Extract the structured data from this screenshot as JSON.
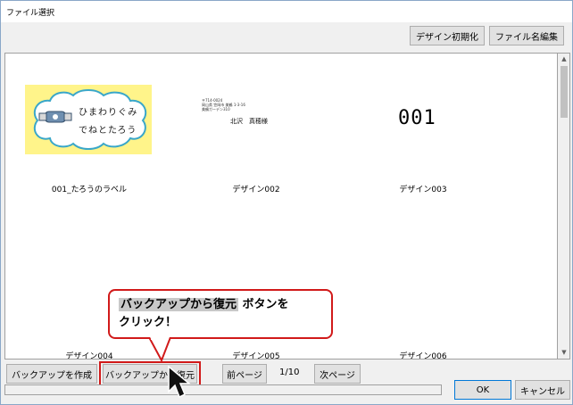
{
  "window": {
    "title": "ファイル選択"
  },
  "toolbar": {
    "reset_design": "デザイン初期化",
    "edit_filename": "ファイル名編集"
  },
  "thumbnails": [
    {
      "caption": "001_たろうのラベル",
      "lines": [
        "ひまわりぐみ",
        "でねとたろう"
      ]
    },
    {
      "caption": "デザイン002",
      "address": [
        "〒714-0024",
        "岡山県 笠岡市 美鶴 1-3-16",
        "美鶴ガーデン310"
      ],
      "name": "北沢　真穂様"
    },
    {
      "caption": "デザイン003",
      "number": "001"
    }
  ],
  "row2_captions": [
    "デザイン004",
    "デザイン005",
    "デザイン006"
  ],
  "callout": {
    "highlight": "バックアップから復元",
    "line1_rest": " ボタンを",
    "line2": "クリック！"
  },
  "bottom": {
    "create_backup": "バックアップを作成",
    "restore_backup": "バックアップから復元",
    "prev_page": "前ページ",
    "page_indicator": "1/10",
    "next_page": "次ページ",
    "ok": "OK",
    "cancel": "キャンセル"
  },
  "colors": {
    "accent_red": "#d11a1a",
    "label_yellow": "#fff48a",
    "focus_blue": "#0078d7"
  }
}
